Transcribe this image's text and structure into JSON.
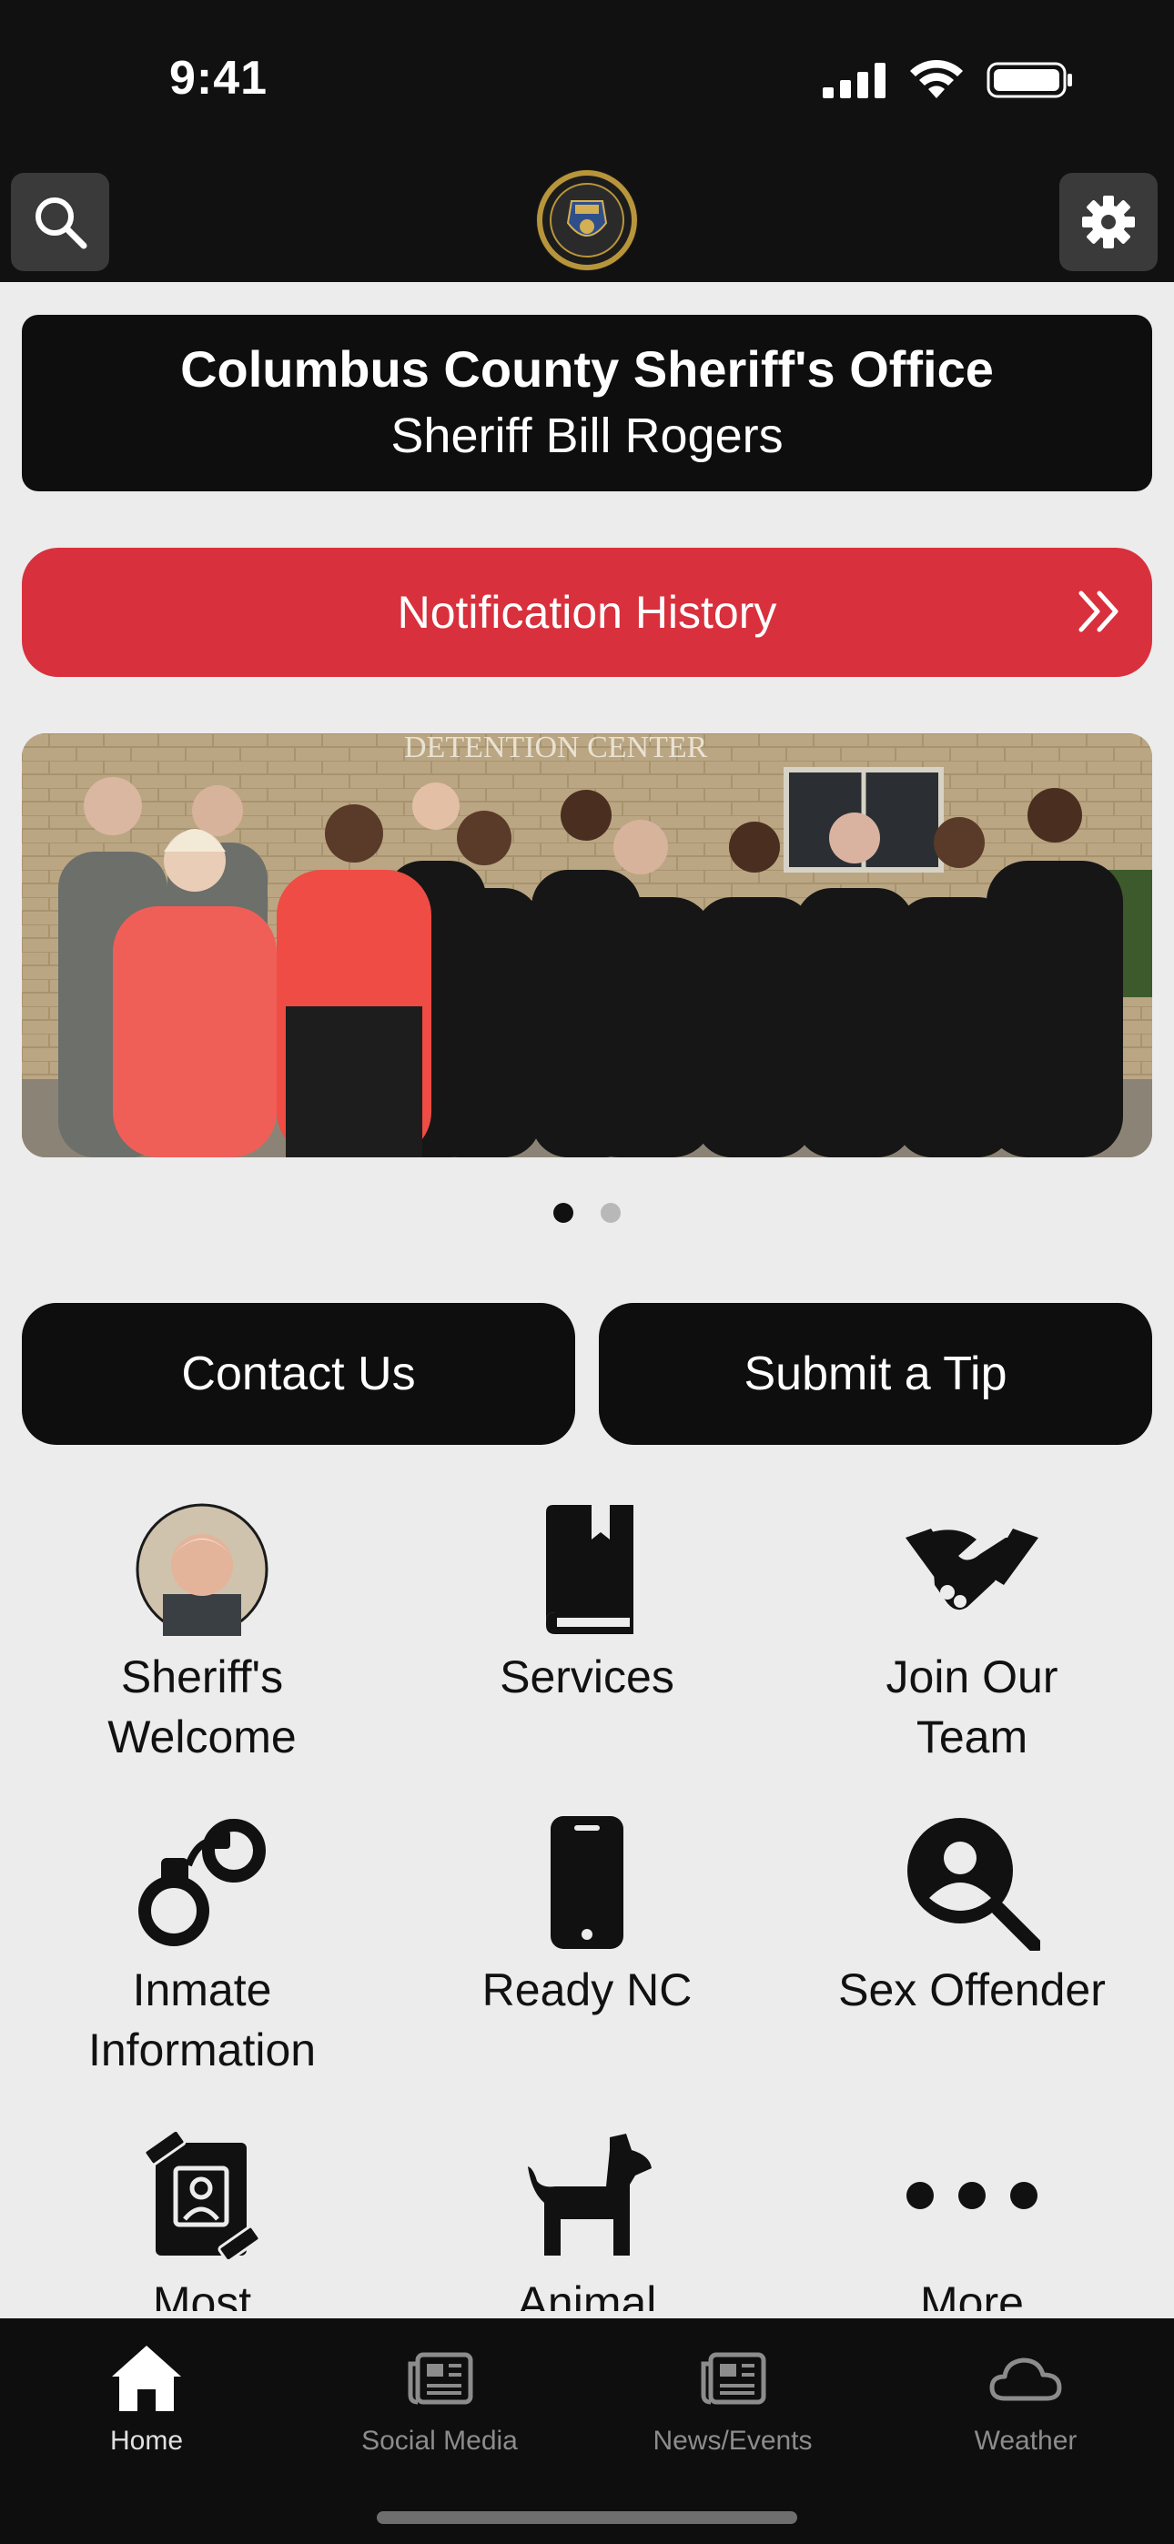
{
  "status": {
    "time": "9:41"
  },
  "header": {
    "search_icon": "search-icon",
    "logo": "sheriff-badge-logo",
    "settings_icon": "gear-icon"
  },
  "title_card": {
    "line1": "Columbus County Sheriff's Office",
    "line2": "Sheriff Bill Rogers"
  },
  "notification": {
    "label": "Notification History",
    "icon": "double-chevron-right-icon"
  },
  "carousel": {
    "banner_text": "DETENTION CENTER",
    "page_count": 2,
    "active_page": 1
  },
  "actions": {
    "contact_label": "Contact Us",
    "tip_label": "Submit a Tip"
  },
  "tiles": [
    {
      "label": "Sheriff's Welcome",
      "icon": "sheriff-portrait"
    },
    {
      "label": "Services",
      "icon": "book-icon"
    },
    {
      "label": "Join Our Team",
      "icon": "handshake-icon"
    },
    {
      "label": "Inmate Information",
      "icon": "handcuffs-icon"
    },
    {
      "label": "Ready NC",
      "icon": "phone-icon"
    },
    {
      "label": "Sex Offender",
      "icon": "user-search-icon"
    },
    {
      "label": "Most",
      "icon": "wanted-poster-icon"
    },
    {
      "label": "Animal",
      "icon": "dog-icon"
    },
    {
      "label": "More",
      "icon": "ellipsis-icon"
    }
  ],
  "tabbar": {
    "tabs": [
      {
        "label": "Home",
        "icon": "home-icon",
        "active": true
      },
      {
        "label": "Social Media",
        "icon": "newspaper-icon",
        "active": false
      },
      {
        "label": "News/Events",
        "icon": "newspaper-icon",
        "active": false
      },
      {
        "label": "Weather",
        "icon": "cloud-icon",
        "active": false
      }
    ]
  },
  "colors": {
    "bar_bg": "#111111",
    "accent_red": "#d9303d",
    "page_bg": "#ececec"
  }
}
